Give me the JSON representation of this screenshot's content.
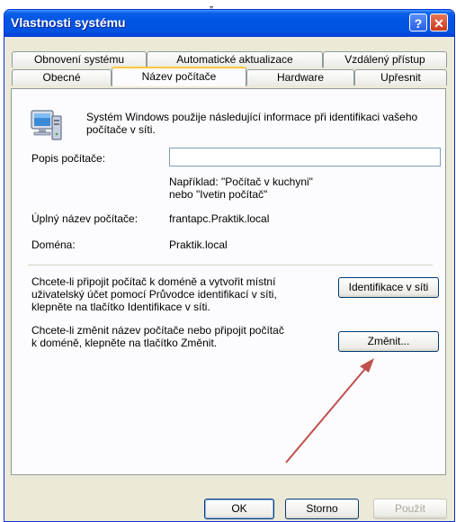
{
  "top_mark": "„",
  "window": {
    "title": "Vlastnosti systému",
    "help_button": "?",
    "close_button": "✕"
  },
  "tabs_back": [
    "Obnovení systému",
    "Automatické aktualizace",
    "Vzdálený přístup"
  ],
  "tabs_front": [
    "Obecné",
    "Název počítače",
    "Hardware",
    "Upřesnit"
  ],
  "active_tab": "Název počítače",
  "panel": {
    "intro": [
      "Systém Windows použije následující informace při identifikaci vašeho",
      "počítače v síti."
    ],
    "description_label": "Popis počítače:",
    "description_value": "",
    "example": [
      "Například: \"Počítač v kuchyni\"",
      "nebo \"Ivetin počítač\""
    ],
    "full_name_label": "Úplný název počítače:",
    "full_name_value": "frantapc.Praktik.local",
    "domain_label": "Doména:",
    "domain_value": "Praktik.local",
    "network_id_text": [
      "Chcete-li připojit počítač k doméně a vytvořit místní",
      "uživatelský účet pomocí Průvodce identifikací v síti,",
      "klepněte na tlačítko Identifikace v síti."
    ],
    "network_id_button": "Identifikace v síti",
    "change_text": [
      "Chcete-li změnit název počítače nebo připojit počítač",
      "k doméně, klepněte na tlačítko Změnit."
    ],
    "change_button": "Změnit..."
  },
  "footer": {
    "ok": "OK",
    "cancel": "Storno",
    "apply": "Použít"
  },
  "colors": {
    "annotation_arrow": "#c0504d",
    "titlebar": "#0054e3"
  }
}
